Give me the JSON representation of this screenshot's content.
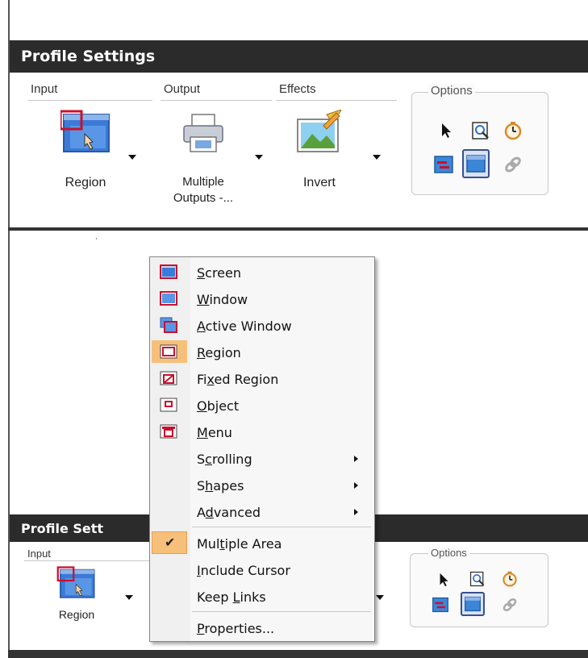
{
  "top_panel": {
    "title": "Profile Settings",
    "groups": {
      "input": "Input",
      "output": "Output",
      "effects": "Effects",
      "options": "Options"
    },
    "tools": {
      "input": "Region",
      "output_line1": "Multiple",
      "output_line2": "Outputs -...",
      "effects": "Invert"
    }
  },
  "bottom_panel": {
    "title": "Profile Sett",
    "groups": {
      "input": "Input",
      "options": "Options"
    },
    "tools": {
      "input": "Region"
    }
  },
  "context_menu": {
    "items": [
      {
        "label": "Screen",
        "key": "S",
        "rest": "creen",
        "prefix": "",
        "icon": "screen-icon"
      },
      {
        "label": "Window",
        "key": "W",
        "rest": "indow",
        "prefix": "",
        "icon": "window-icon"
      },
      {
        "label": "Active Window",
        "key": "A",
        "rest": "ctive Window",
        "prefix": "",
        "icon": "active-window-icon"
      },
      {
        "label": "Region",
        "key": "R",
        "rest": "egion",
        "prefix": "",
        "icon": "region-icon",
        "selected": true
      },
      {
        "label": "Fixed Region",
        "key": "x",
        "rest": "ed Region",
        "prefix": "Fi",
        "icon": "fixed-region-icon"
      },
      {
        "label": "Object",
        "key": "O",
        "rest": "bject",
        "prefix": "",
        "icon": "object-icon"
      },
      {
        "label": "Menu",
        "key": "M",
        "rest": "enu",
        "prefix": "",
        "icon": "menu-icon"
      },
      {
        "label": "Scrolling",
        "key": "c",
        "rest": "rolling",
        "prefix": "S",
        "submenu": true
      },
      {
        "label": "Shapes",
        "key": "h",
        "rest": "apes",
        "prefix": "S",
        "submenu": true
      },
      {
        "label": "Advanced",
        "key": "d",
        "rest": "vanced",
        "prefix": "A",
        "submenu": true
      },
      {
        "label": "Multiple Area",
        "key": "t",
        "rest": "iple Area",
        "prefix": "Mul",
        "checked": true
      },
      {
        "label": "Include Cursor",
        "key": "I",
        "rest": "nclude Cursor",
        "prefix": ""
      },
      {
        "label": "Keep Links",
        "key": "L",
        "rest": "inks",
        "prefix": "Keep "
      },
      {
        "label": "Properties...",
        "key": "P",
        "rest": "roperties...",
        "prefix": ""
      }
    ]
  },
  "colors": {
    "title_bar": "#2b2b2b",
    "menu_highlight": "#f7c07a",
    "region_icon_red": "#c8102e",
    "icon_blue": "#2a6fc9"
  }
}
